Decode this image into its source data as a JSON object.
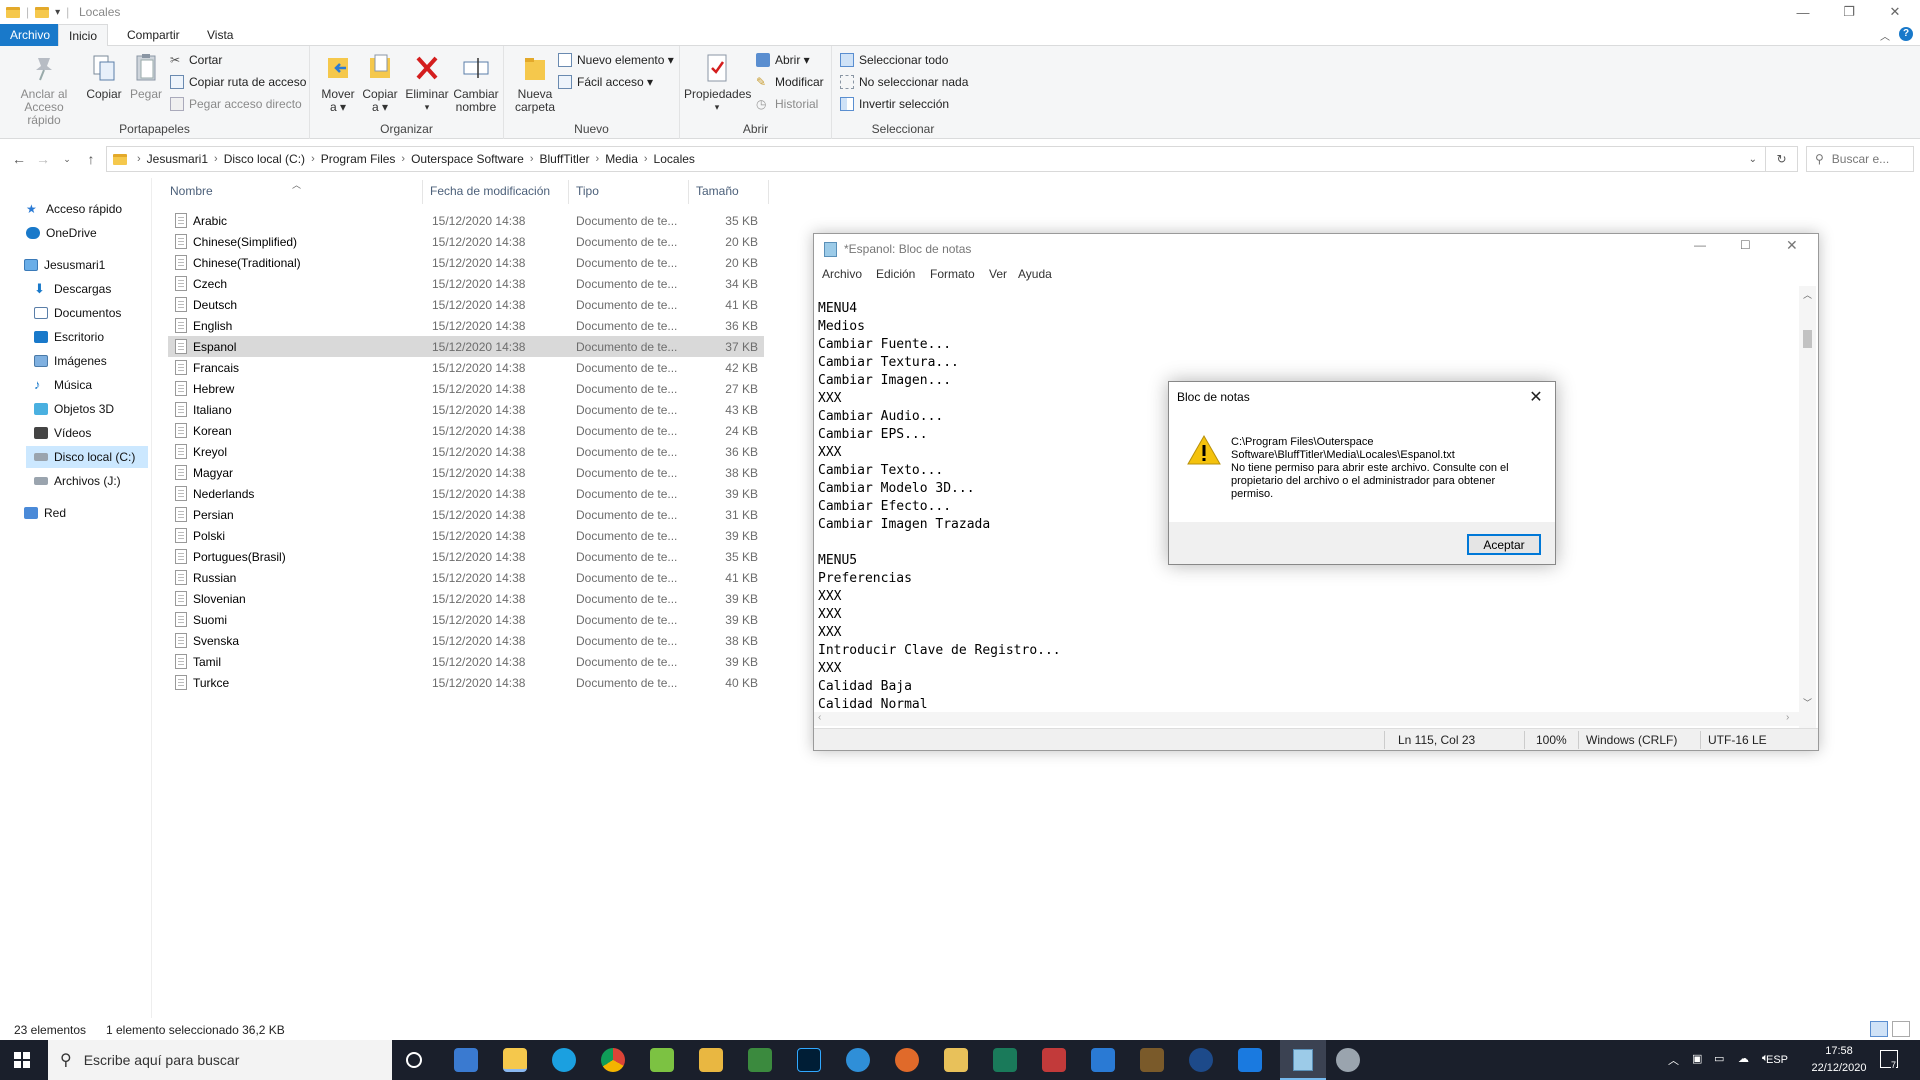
{
  "explorer": {
    "title": "Locales",
    "tabs": {
      "file": "Archivo",
      "home": "Inicio",
      "share": "Compartir",
      "view": "Vista"
    },
    "ribbon": {
      "clipboard": {
        "label": "Portapapeles",
        "pin": "Anclar al\nAcceso rápido",
        "pin1": "Anclar al",
        "pin2": "Acceso rápido",
        "copy": "Copiar",
        "paste": "Pegar",
        "cut": "Cortar",
        "copy_path": "Copiar ruta de acceso",
        "paste_shortcut": "Pegar acceso directo"
      },
      "organize": {
        "label": "Organizar",
        "move1": "Mover",
        "move2": "a ▾",
        "copyto1": "Copiar",
        "copyto2": "a ▾",
        "delete": "Eliminar",
        "rename1": "Cambiar",
        "rename2": "nombre"
      },
      "new": {
        "label": "Nuevo",
        "new_item": "Nuevo elemento ▾",
        "easy_access": "Fácil acceso ▾",
        "new_folder1": "Nueva",
        "new_folder2": "carpeta"
      },
      "open": {
        "label": "Abrir",
        "properties": "Propiedades",
        "open": "Abrir ▾",
        "edit": "Modificar",
        "history": "Historial"
      },
      "select": {
        "label": "Seleccionar",
        "select_all": "Seleccionar todo",
        "select_none": "No seleccionar nada",
        "invert": "Invertir selección"
      }
    },
    "breadcrumb": [
      "Jesusmari1",
      "Disco local (C:)",
      "Program Files",
      "Outerspace Software",
      "BluffTitler",
      "Media",
      "Locales"
    ],
    "search_placeholder": "Buscar e...",
    "nav": {
      "quick_access": "Acceso rápido",
      "onedrive": "OneDrive",
      "pc": "Jesusmari1",
      "downloads": "Descargas",
      "documents": "Documentos",
      "desktop": "Escritorio",
      "pictures": "Imágenes",
      "music": "Música",
      "objects3d": "Objetos 3D",
      "videos": "Vídeos",
      "local_disk": "Disco local (C:)",
      "archives": "Archivos (J:)",
      "network": "Red"
    },
    "columns": {
      "name": "Nombre",
      "date": "Fecha de modificación",
      "type": "Tipo",
      "size": "Tamaño"
    },
    "files": [
      {
        "name": "Arabic",
        "date": "15/12/2020 14:38",
        "type": "Documento de te...",
        "size": "35 KB"
      },
      {
        "name": "Chinese(Simplified)",
        "date": "15/12/2020 14:38",
        "type": "Documento de te...",
        "size": "20 KB"
      },
      {
        "name": "Chinese(Traditional)",
        "date": "15/12/2020 14:38",
        "type": "Documento de te...",
        "size": "20 KB"
      },
      {
        "name": "Czech",
        "date": "15/12/2020 14:38",
        "type": "Documento de te...",
        "size": "34 KB"
      },
      {
        "name": "Deutsch",
        "date": "15/12/2020 14:38",
        "type": "Documento de te...",
        "size": "41 KB"
      },
      {
        "name": "English",
        "date": "15/12/2020 14:38",
        "type": "Documento de te...",
        "size": "36 KB"
      },
      {
        "name": "Espanol",
        "date": "15/12/2020 14:38",
        "type": "Documento de te...",
        "size": "37 KB"
      },
      {
        "name": "Francais",
        "date": "15/12/2020 14:38",
        "type": "Documento de te...",
        "size": "42 KB"
      },
      {
        "name": "Hebrew",
        "date": "15/12/2020 14:38",
        "type": "Documento de te...",
        "size": "27 KB"
      },
      {
        "name": "Italiano",
        "date": "15/12/2020 14:38",
        "type": "Documento de te...",
        "size": "43 KB"
      },
      {
        "name": "Korean",
        "date": "15/12/2020 14:38",
        "type": "Documento de te...",
        "size": "24 KB"
      },
      {
        "name": "Kreyol",
        "date": "15/12/2020 14:38",
        "type": "Documento de te...",
        "size": "36 KB"
      },
      {
        "name": "Magyar",
        "date": "15/12/2020 14:38",
        "type": "Documento de te...",
        "size": "38 KB"
      },
      {
        "name": "Nederlands",
        "date": "15/12/2020 14:38",
        "type": "Documento de te...",
        "size": "39 KB"
      },
      {
        "name": "Persian",
        "date": "15/12/2020 14:38",
        "type": "Documento de te...",
        "size": "31 KB"
      },
      {
        "name": "Polski",
        "date": "15/12/2020 14:38",
        "type": "Documento de te...",
        "size": "39 KB"
      },
      {
        "name": "Portugues(Brasil)",
        "date": "15/12/2020 14:38",
        "type": "Documento de te...",
        "size": "35 KB"
      },
      {
        "name": "Russian",
        "date": "15/12/2020 14:38",
        "type": "Documento de te...",
        "size": "41 KB"
      },
      {
        "name": "Slovenian",
        "date": "15/12/2020 14:38",
        "type": "Documento de te...",
        "size": "39 KB"
      },
      {
        "name": "Suomi",
        "date": "15/12/2020 14:38",
        "type": "Documento de te...",
        "size": "39 KB"
      },
      {
        "name": "Svenska",
        "date": "15/12/2020 14:38",
        "type": "Documento de te...",
        "size": "38 KB"
      },
      {
        "name": "Tamil",
        "date": "15/12/2020 14:38",
        "type": "Documento de te...",
        "size": "39 KB"
      },
      {
        "name": "Turkce",
        "date": "15/12/2020 14:38",
        "type": "Documento de te...",
        "size": "40 KB"
      }
    ],
    "status": {
      "count": "23 elementos",
      "selected": "1 elemento seleccionado 36,2 KB"
    }
  },
  "notepad": {
    "title": "*Espanol: Bloc de notas",
    "menu": [
      "Archivo",
      "Edición",
      "Formato",
      "Ver",
      "Ayuda"
    ],
    "lines": [
      "MENU4",
      "Medios",
      "Cambiar Fuente...",
      "Cambiar Textura...",
      "Cambiar Imagen...",
      "XXX",
      "Cambiar Audio...",
      "Cambiar EPS...",
      "XXX",
      "Cambiar Texto...",
      "Cambiar Modelo 3D...",
      "Cambiar Efecto...",
      "Cambiar Imagen Trazada",
      "",
      "MENU5",
      "Preferencias",
      "XXX",
      "XXX",
      "XXX",
      "Introducir Clave de Registro...",
      "XXX",
      "Calidad Baja",
      "Calidad Normal"
    ],
    "status": {
      "position": "Ln 115, Col 23",
      "zoom": "100%",
      "eol": "Windows (CRLF)",
      "encoding": "UTF-16 LE"
    }
  },
  "dialog": {
    "title": "Bloc de notas",
    "path_line1": "C:\\Program Files\\Outerspace",
    "path_line2": "Software\\BluffTitler\\Media\\Locales\\Espanol.txt",
    "message": "No tiene permiso para abrir este archivo. Consulte con el propietario del archivo o el administrador para obtener permiso.",
    "ok": "Aceptar"
  },
  "taskbar": {
    "search_placeholder": "Escribe aquí para buscar",
    "lang": "ESP",
    "time": "17:58",
    "date": "22/12/2020",
    "notif_count": "7"
  },
  "colors": {
    "accent": "#0078d7",
    "file_tab": "#1979ca",
    "taskbar": "#1a1f2b",
    "warning": "#f4c20d"
  }
}
